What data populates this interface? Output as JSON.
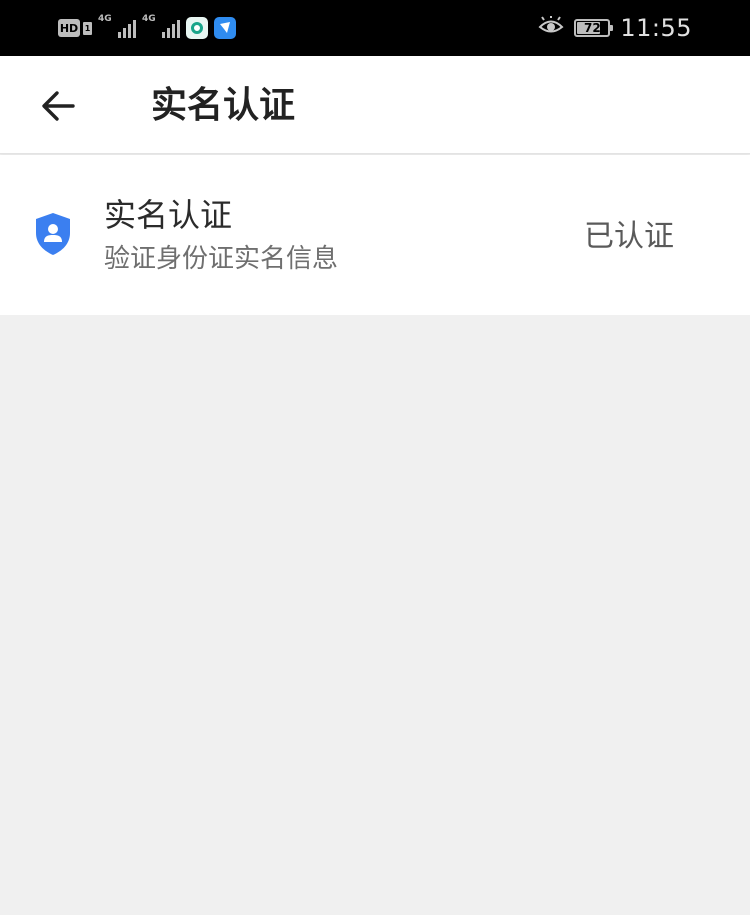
{
  "status_bar": {
    "hd": "HD",
    "sim": "1",
    "signal_1_tag": "4G",
    "signal_2_tag": "4G",
    "icons": [
      "app-icon-green",
      "app-icon-blue",
      "eye-comfort-icon"
    ],
    "battery_level": "72",
    "battery_fraction": 0.72,
    "time": "11:55"
  },
  "header": {
    "back_icon": "arrow-left-icon",
    "title": "实名认证"
  },
  "verify_row": {
    "icon": "shield-user-icon",
    "icon_color": "#3b7ff0",
    "title": "实名认证",
    "subtitle": "验证身份证实名信息",
    "status": "已认证"
  }
}
